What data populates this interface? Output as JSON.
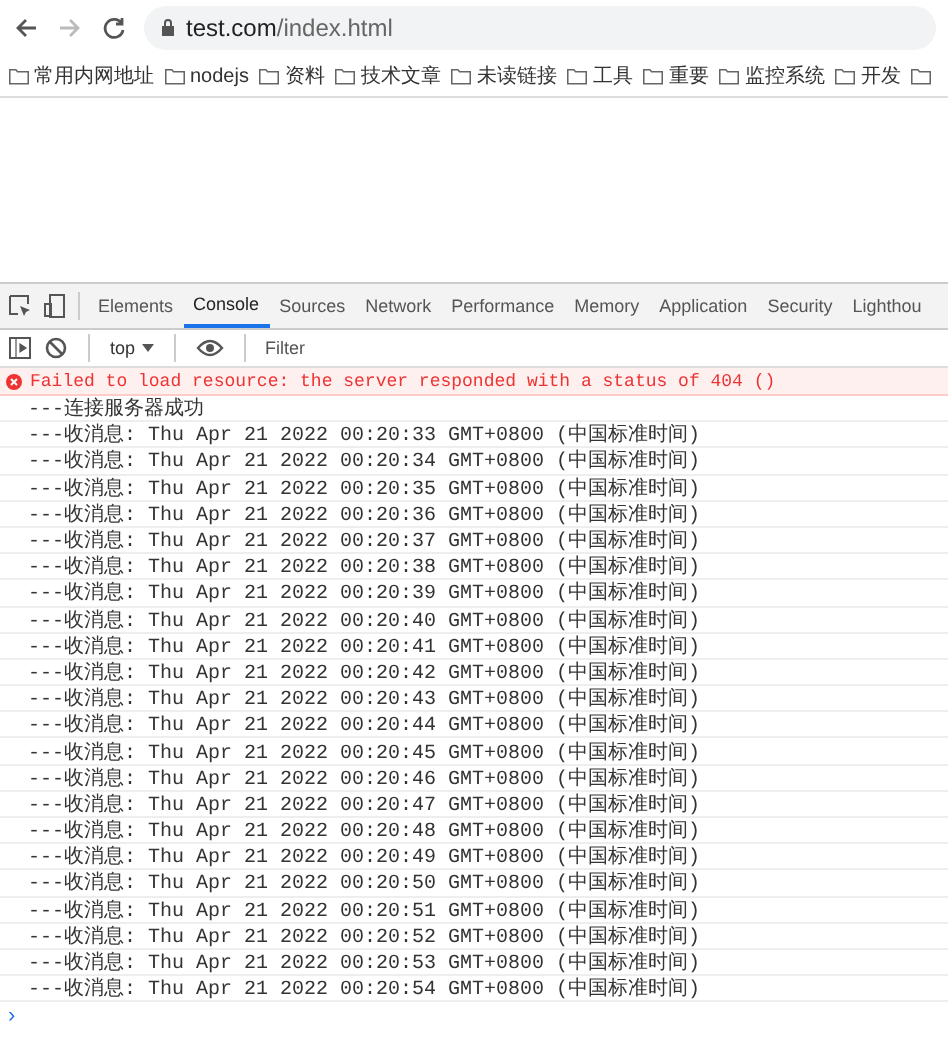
{
  "browser": {
    "url_host": "test.com",
    "url_path": "/index.html"
  },
  "bookmarks": [
    "常用内网地址",
    "nodejs",
    "资料",
    "技术文章",
    "未读链接",
    "工具",
    "重要",
    "监控系统",
    "开发"
  ],
  "devtools": {
    "tabs": [
      {
        "label": "Elements",
        "selected": false
      },
      {
        "label": "Console",
        "selected": true
      },
      {
        "label": "Sources",
        "selected": false
      },
      {
        "label": "Network",
        "selected": false
      },
      {
        "label": "Performance",
        "selected": false
      },
      {
        "label": "Memory",
        "selected": false
      },
      {
        "label": "Application",
        "selected": false
      },
      {
        "label": "Security",
        "selected": false
      },
      {
        "label": "Lighthou",
        "selected": false
      }
    ],
    "context": "top",
    "filter_placeholder": "Filter",
    "messages": [
      {
        "kind": "error",
        "text": "Failed to load resource: the server responded with a status of 404 ()"
      },
      {
        "kind": "log",
        "text": "---连接服务器成功"
      },
      {
        "kind": "log",
        "text": "---收消息:  Thu Apr 21 2022 00:20:33 GMT+0800 (中国标准时间)"
      },
      {
        "kind": "log",
        "text": "---收消息:  Thu Apr 21 2022 00:20:34 GMT+0800 (中国标准时间)"
      },
      {
        "kind": "log",
        "text": "---收消息:  Thu Apr 21 2022 00:20:35 GMT+0800 (中国标准时间)"
      },
      {
        "kind": "log",
        "text": "---收消息:  Thu Apr 21 2022 00:20:36 GMT+0800 (中国标准时间)"
      },
      {
        "kind": "log",
        "text": "---收消息:  Thu Apr 21 2022 00:20:37 GMT+0800 (中国标准时间)"
      },
      {
        "kind": "log",
        "text": "---收消息:  Thu Apr 21 2022 00:20:38 GMT+0800 (中国标准时间)"
      },
      {
        "kind": "log",
        "text": "---收消息:  Thu Apr 21 2022 00:20:39 GMT+0800 (中国标准时间)"
      },
      {
        "kind": "log",
        "text": "---收消息:  Thu Apr 21 2022 00:20:40 GMT+0800 (中国标准时间)"
      },
      {
        "kind": "log",
        "text": "---收消息:  Thu Apr 21 2022 00:20:41 GMT+0800 (中国标准时间)"
      },
      {
        "kind": "log",
        "text": "---收消息:  Thu Apr 21 2022 00:20:42 GMT+0800 (中国标准时间)"
      },
      {
        "kind": "log",
        "text": "---收消息:  Thu Apr 21 2022 00:20:43 GMT+0800 (中国标准时间)"
      },
      {
        "kind": "log",
        "text": "---收消息:  Thu Apr 21 2022 00:20:44 GMT+0800 (中国标准时间)"
      },
      {
        "kind": "log",
        "text": "---收消息:  Thu Apr 21 2022 00:20:45 GMT+0800 (中国标准时间)"
      },
      {
        "kind": "log",
        "text": "---收消息:  Thu Apr 21 2022 00:20:46 GMT+0800 (中国标准时间)"
      },
      {
        "kind": "log",
        "text": "---收消息:  Thu Apr 21 2022 00:20:47 GMT+0800 (中国标准时间)"
      },
      {
        "kind": "log",
        "text": "---收消息:  Thu Apr 21 2022 00:20:48 GMT+0800 (中国标准时间)"
      },
      {
        "kind": "log",
        "text": "---收消息:  Thu Apr 21 2022 00:20:49 GMT+0800 (中国标准时间)"
      },
      {
        "kind": "log",
        "text": "---收消息:  Thu Apr 21 2022 00:20:50 GMT+0800 (中国标准时间)"
      },
      {
        "kind": "log",
        "text": "---收消息:  Thu Apr 21 2022 00:20:51 GMT+0800 (中国标准时间)"
      },
      {
        "kind": "log",
        "text": "---收消息:  Thu Apr 21 2022 00:20:52 GMT+0800 (中国标准时间)"
      },
      {
        "kind": "log",
        "text": "---收消息:  Thu Apr 21 2022 00:20:53 GMT+0800 (中国标准时间)"
      },
      {
        "kind": "log",
        "text": "---收消息:  Thu Apr 21 2022 00:20:54 GMT+0800 (中国标准时间)"
      }
    ],
    "prompt": "›"
  }
}
